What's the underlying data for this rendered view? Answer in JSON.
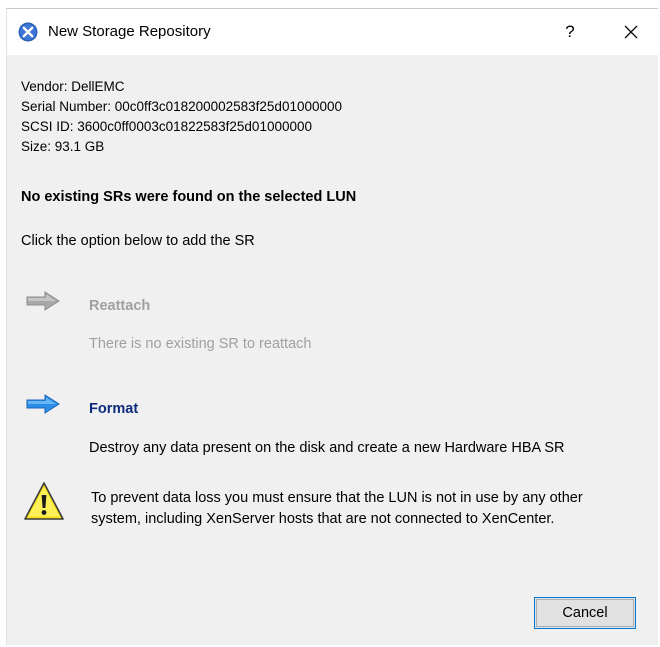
{
  "window": {
    "title": "New Storage Repository",
    "help_label": "?"
  },
  "lun_info": {
    "vendor": "Vendor: DellEMC",
    "serial": "Serial Number: 00c0ff3c018200002583f25d01000000",
    "scsi_id": "SCSI ID: 3600c0ff0003c01822583f25d01000000",
    "size": "Size: 93.1 GB"
  },
  "heading": "No existing SRs were found on the selected LUN",
  "instruction": "Click the option below to add the SR",
  "options": [
    {
      "title": "Reattach",
      "description": "There is no existing SR to reattach",
      "enabled": false,
      "arrow_color": "#a8a8a8"
    },
    {
      "title": "Format",
      "description": "Destroy any data present on the disk and create a new Hardware HBA SR",
      "enabled": true,
      "arrow_color": "#2a8de8"
    }
  ],
  "warning": {
    "icon": "warning-icon",
    "text": "To prevent data loss you must ensure that the LUN is not in use by any other system, including XenServer hosts that are not connected to XenCenter."
  },
  "buttons": {
    "cancel": "Cancel"
  },
  "colors": {
    "dialog_bg": "#f0f0f0",
    "titlebar_bg": "#ffffff",
    "link_text": "#0d2b7c",
    "disabled_text": "#a0a0a0",
    "focus_border": "#0078d7"
  }
}
